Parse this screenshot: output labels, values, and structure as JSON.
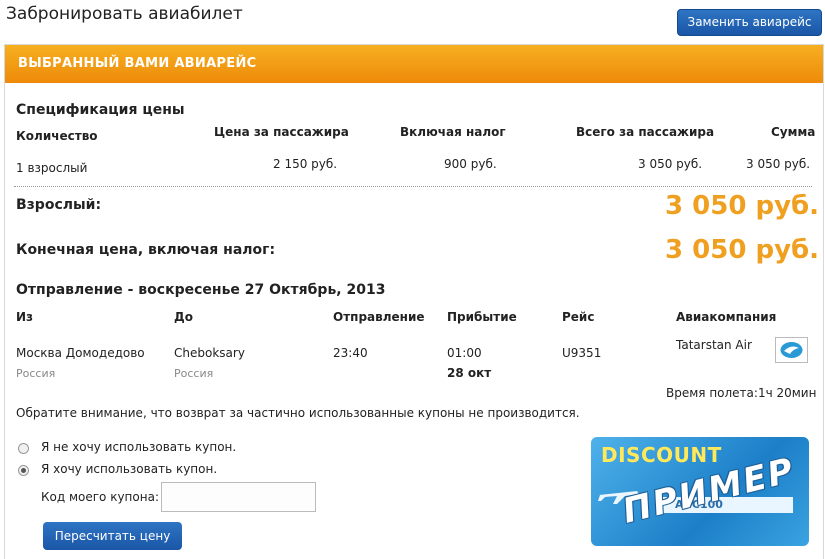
{
  "header": {
    "title": "Забронировать авиабилет",
    "change_flight": "Заменить авиарейс"
  },
  "banner": {
    "title": "ВЫБРАННЫЙ ВАМИ АВИАРЕЙС"
  },
  "price_spec": {
    "title": "Спецификация цены",
    "columns": [
      "Количество",
      "Цена за пассажира",
      "Включая налог",
      "Всего за пассажира",
      "Сумма"
    ],
    "row": [
      "1 взрослый",
      "2 150 руб.",
      "900 руб.",
      "3 050 руб.",
      "3 050 руб."
    ]
  },
  "totals": {
    "adult_label": "Взрослый:",
    "adult_value": "3 050 руб.",
    "final_label": "Конечная цена, включая налог:",
    "final_value": "3 050 руб."
  },
  "departure": {
    "title": "Отправление - воскресенье 27 Октябрь, 2013",
    "columns": [
      "Из",
      "До",
      "Отправление",
      "Прибытие",
      "Рейс",
      "Авиакомпания"
    ],
    "from_city": "Москва Домодедово",
    "from_country": "Россия",
    "to_city": "Cheboksary",
    "to_country": "Россия",
    "dep_time": "23:40",
    "arr_time": "01:00",
    "arr_date": "28 окт",
    "flight": "U9351",
    "airline": "Tatarstan Air",
    "flight_time": "Время полета:1ч 20мин"
  },
  "notice": "Обратите внимание, что возврат за частично использованные купоны не производится.",
  "coupon": {
    "option_no": "Я не хочу использовать купон.",
    "option_yes": "Я хочу использовать купон.",
    "code_label": "Код моего купона:",
    "code_value": "",
    "recalc": "Пересчитать цену",
    "card_title": "DISCOUNT",
    "card_code": "ABC100",
    "card_stamp": "ПРИМЕР"
  },
  "colors": {
    "accent_orange": "#f0a020",
    "button_blue": "#1a56a6"
  },
  "icons": [
    "airline-logo-icon",
    "radio-icon",
    "plane-icon"
  ]
}
